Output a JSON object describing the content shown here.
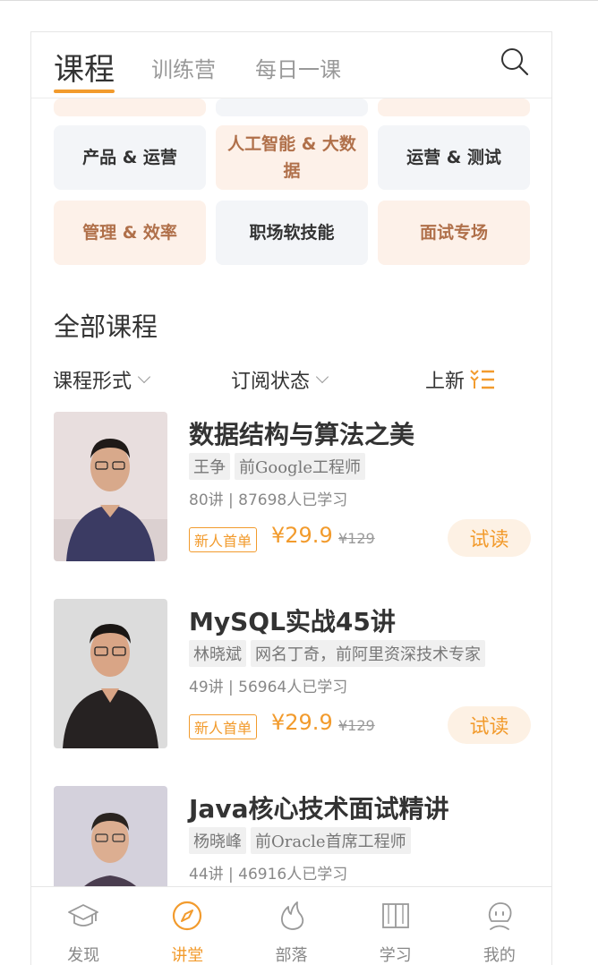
{
  "header": {
    "tabs": [
      {
        "label": "课程"
      },
      {
        "label": "训练营"
      },
      {
        "label": "每日一课"
      }
    ]
  },
  "categories": [
    {
      "label": "产品 & 运营"
    },
    {
      "label": "人工智能 & 大数据"
    },
    {
      "label": "运营 & 测试"
    },
    {
      "label": "管理 & 效率"
    },
    {
      "label": "职场软技能"
    },
    {
      "label": "面试专场"
    }
  ],
  "all_courses": {
    "title": "全部课程",
    "filters": {
      "format": "课程形式",
      "status": "订阅状态",
      "sort": "上新"
    }
  },
  "courses": [
    {
      "title": "数据结构与算法之美",
      "author": "王争",
      "author_title": "前Google工程师",
      "meta": "80讲 | 87698人已学习",
      "badge": "新人首单",
      "price": "¥29.9",
      "old_price": "¥129",
      "action": "试读"
    },
    {
      "title": "MySQL实战45讲",
      "author": "林晓斌",
      "author_title": "网名丁奇，前阿里资深技术专家",
      "meta": "49讲 | 56964人已学习",
      "badge": "新人首单",
      "price": "¥29.9",
      "old_price": "¥129",
      "action": "试读"
    },
    {
      "title": "Java核心技术面试精讲",
      "author": "杨晓峰",
      "author_title": "前Oracle首席工程师",
      "meta": "44讲 | 46916人已学习"
    }
  ],
  "bottom_nav": [
    {
      "label": "发现",
      "icon": "graduation-cap-icon"
    },
    {
      "label": "讲堂",
      "icon": "compass-icon",
      "active": true
    },
    {
      "label": "部落",
      "icon": "flame-icon"
    },
    {
      "label": "学习",
      "icon": "book-icon"
    },
    {
      "label": "我的",
      "icon": "profile-icon"
    }
  ],
  "colors": {
    "accent": "#f29b2d",
    "category_orange_bg": "#fdf1e9",
    "category_gray_bg": "#f3f5f8"
  }
}
